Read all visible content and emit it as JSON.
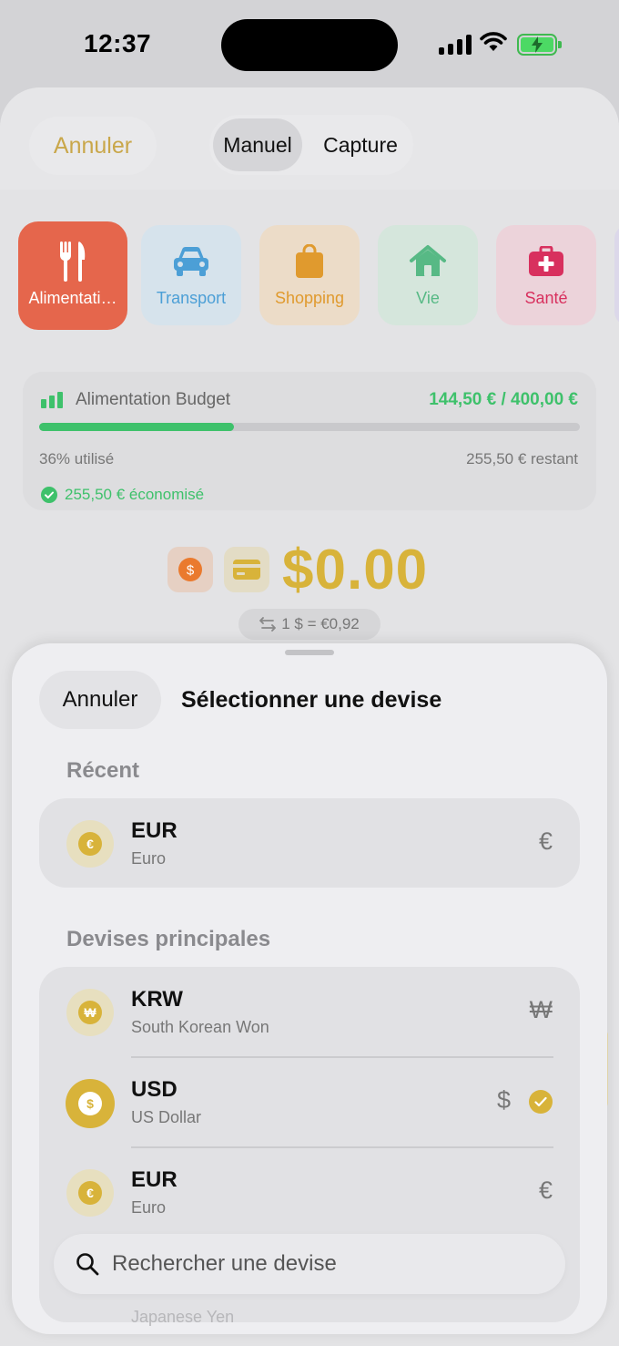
{
  "status_bar": {
    "time": "12:37"
  },
  "background": {
    "cancel_label": "Annuler",
    "mode_tabs": {
      "manual": "Manuel",
      "capture": "Capture"
    },
    "categories": [
      {
        "label": "Alimentati…",
        "icon": "fork-knife-icon",
        "color": "#e5664c"
      },
      {
        "label": "Transport",
        "icon": "car-icon",
        "color": "#4c9fd6"
      },
      {
        "label": "Shopping",
        "icon": "shopping-bag-icon",
        "color": "#e09a2e"
      },
      {
        "label": "Vie",
        "icon": "house-icon",
        "color": "#57b985"
      },
      {
        "label": "Santé",
        "icon": "first-aid-kit-icon",
        "color": "#d8305e"
      }
    ],
    "budget": {
      "title": "Alimentation Budget",
      "amount": "144,50 € / 400,00 €",
      "progress_fraction": 0.36,
      "used_text": "36% utilisé",
      "remaining_text": "255,50 € restant",
      "saved_text": "255,50 € économisé"
    },
    "amount_display": "$0.00",
    "exchange_rate": "1 $ = €0,92"
  },
  "picker": {
    "cancel_label": "Annuler",
    "title": "Sélectionner une devise",
    "recent_label": "Récent",
    "recent": [
      {
        "code": "EUR",
        "name": "Euro",
        "symbol": "€",
        "coin": "€"
      }
    ],
    "main_label": "Devises principales",
    "main": [
      {
        "code": "KRW",
        "name": "South Korean Won",
        "symbol": "₩",
        "coin": "₩"
      },
      {
        "code": "USD",
        "name": "US Dollar",
        "symbol": "$",
        "coin": "$",
        "selected": true
      },
      {
        "code": "EUR",
        "name": "Euro",
        "symbol": "€",
        "coin": "€"
      }
    ],
    "partial_next_name": "Japanese Yen",
    "search_placeholder": "Rechercher une devise"
  },
  "colors": {
    "accent": "#d8b33a",
    "success": "#3ec16b"
  }
}
